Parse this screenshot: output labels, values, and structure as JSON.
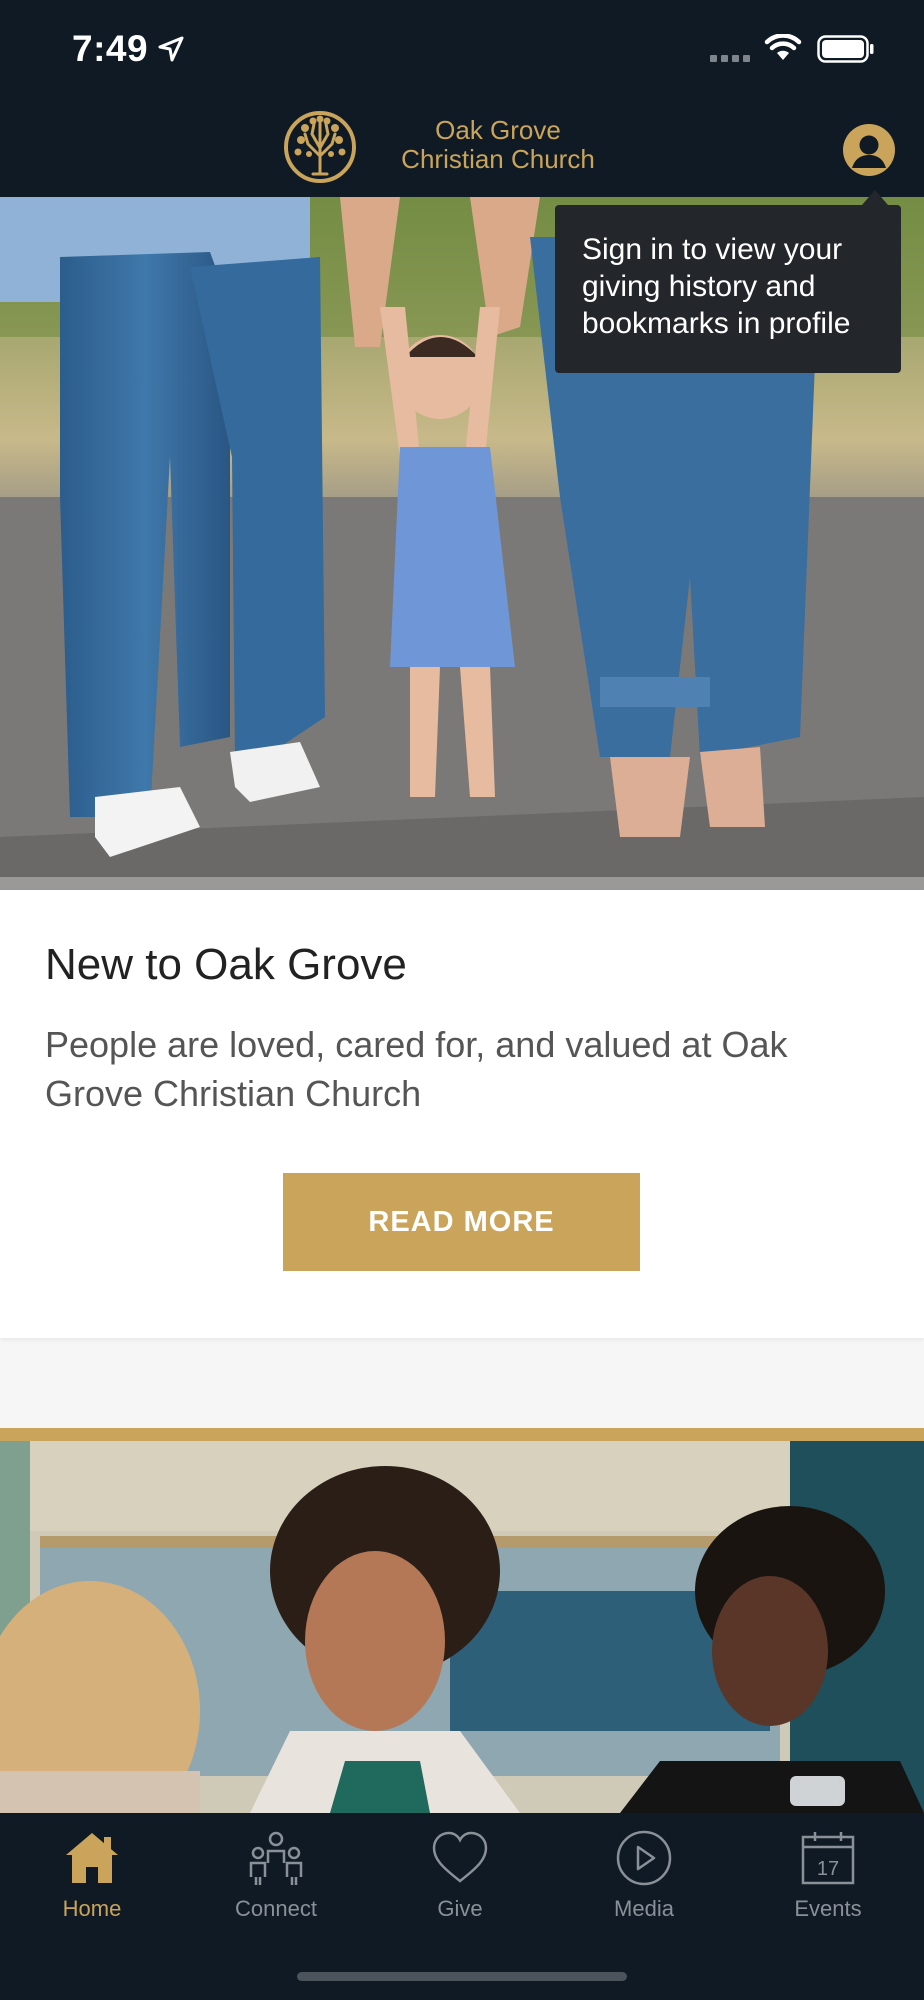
{
  "status_bar": {
    "time": "7:49",
    "icons": [
      "location-arrow-icon",
      "cellular-signal-icon",
      "wifi-icon",
      "battery-icon"
    ]
  },
  "header": {
    "logo_line1": "Oak Grove",
    "logo_line2": "Christian Church",
    "profile_icon": "user-avatar-icon"
  },
  "tooltip": {
    "line1": "Sign in to view your",
    "line2": "giving history and",
    "line3": "bookmarks in profile"
  },
  "card": {
    "title": "New to Oak Grove",
    "description": "People are loved, cared for, and valued at Oak Grove Christian Church",
    "button_label": "READ MORE"
  },
  "tabs": [
    {
      "label": "Home",
      "icon": "home-icon",
      "active": true
    },
    {
      "label": "Connect",
      "icon": "people-icon",
      "active": false
    },
    {
      "label": "Give",
      "icon": "heart-icon",
      "active": false
    },
    {
      "label": "Media",
      "icon": "play-circle-icon",
      "active": false
    },
    {
      "label": "Events",
      "icon": "calendar-icon",
      "active": false,
      "badge": "17"
    }
  ],
  "colors": {
    "accent_gold": "#c9a45a",
    "navy": "#0f1a24",
    "tooltip_bg": "#23272b"
  }
}
